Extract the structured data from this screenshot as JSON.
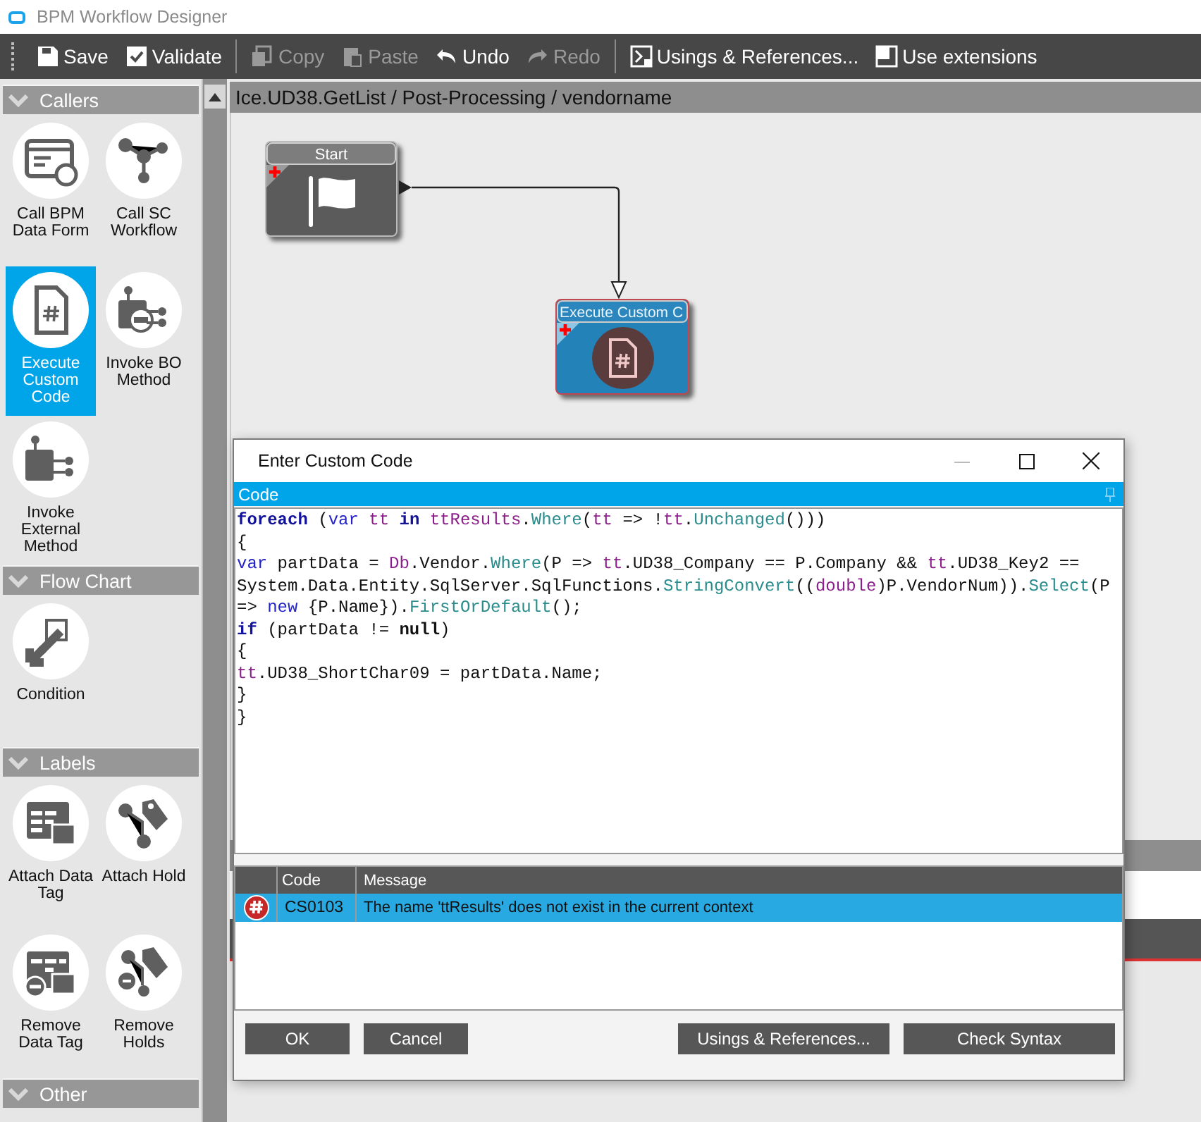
{
  "window": {
    "title": "BPM Workflow Designer"
  },
  "toolbar": {
    "groups": [
      [
        {
          "label": "Save",
          "disabled": false
        },
        {
          "label": "Validate",
          "disabled": false
        }
      ],
      [
        {
          "label": "Copy",
          "disabled": true
        },
        {
          "label": "Paste",
          "disabled": true
        },
        {
          "label": "Undo",
          "disabled": false
        },
        {
          "label": "Redo",
          "disabled": true
        }
      ],
      [
        {
          "label": "Usings & References...",
          "disabled": false
        },
        {
          "label": "Use extensions",
          "disabled": false
        }
      ]
    ]
  },
  "palette": {
    "groups": [
      {
        "title": "Callers",
        "items": [
          {
            "label": "Call BPM Data Form",
            "selected": false
          },
          {
            "label": "Call SC Workflow",
            "selected": false
          },
          {
            "label": "Execute Custom Code",
            "selected": true
          },
          {
            "label": "Invoke BO Method",
            "selected": false
          },
          {
            "label": "Invoke External Method",
            "selected": false
          }
        ]
      },
      {
        "title": "Flow Chart",
        "items": [
          {
            "label": "Condition",
            "selected": false
          }
        ]
      },
      {
        "title": "Labels",
        "items": [
          {
            "label": "Attach Data Tag",
            "selected": false
          },
          {
            "label": "Attach Hold",
            "selected": false
          },
          {
            "label": "Remove Data Tag",
            "selected": false
          },
          {
            "label": "Remove Holds",
            "selected": false
          }
        ]
      },
      {
        "title": "Other"
      }
    ]
  },
  "breadcrumb": "Ice.UD38.GetList / Post-Processing / vendorname",
  "canvas": {
    "nodes": [
      {
        "title": "Start",
        "kind": "start"
      },
      {
        "title": "Execute Custom C",
        "kind": "code"
      }
    ]
  },
  "dialog": {
    "title": "Enter Custom Code",
    "panel_title": "Code",
    "code_lines": [
      [
        {
          "text": "foreach",
          "kind": "keyword"
        },
        {
          "text": " (",
          "kind": "plain"
        },
        {
          "text": "var",
          "kind": "type"
        },
        {
          "text": " tt",
          "kind": "local"
        },
        {
          "text": " in",
          "kind": "keyword"
        },
        {
          "text": " ttResults",
          "kind": "local"
        },
        {
          "text": ".",
          "kind": "plain"
        },
        {
          "text": "Where",
          "kind": "method"
        },
        {
          "text": "(",
          "kind": "plain"
        },
        {
          "text": "tt",
          "kind": "local"
        },
        {
          "text": " => !",
          "kind": "plain"
        },
        {
          "text": "tt",
          "kind": "local"
        },
        {
          "text": ".",
          "kind": "plain"
        },
        {
          "text": "Unchanged",
          "kind": "method"
        },
        {
          "text": "()))",
          "kind": "plain"
        }
      ],
      [
        {
          "text": "{",
          "kind": "plain"
        }
      ],
      [
        {
          "text": "var",
          "kind": "type"
        },
        {
          "text": " partData = ",
          "kind": "plain"
        },
        {
          "text": "Db",
          "kind": "local"
        },
        {
          "text": ".Vendor.",
          "kind": "plain"
        },
        {
          "text": "Where",
          "kind": "method"
        },
        {
          "text": "(P => ",
          "kind": "plain"
        },
        {
          "text": "tt",
          "kind": "local"
        },
        {
          "text": ".UD38_Company == P.Company && ",
          "kind": "plain"
        },
        {
          "text": "tt",
          "kind": "local"
        },
        {
          "text": ".UD38_Key2 ==",
          "kind": "plain"
        }
      ],
      [
        {
          "text": "System.Data.Entity.SqlServer.SqlFunctions.",
          "kind": "plain"
        },
        {
          "text": "StringConvert",
          "kind": "method"
        },
        {
          "text": "((",
          "kind": "plain"
        },
        {
          "text": "double",
          "kind": "local"
        },
        {
          "text": ")P.VendorNum)).",
          "kind": "plain"
        },
        {
          "text": "Select",
          "kind": "method"
        },
        {
          "text": "(P",
          "kind": "plain"
        }
      ],
      [
        {
          "text": "=> ",
          "kind": "plain"
        },
        {
          "text": "new",
          "kind": "type"
        },
        {
          "text": " {P.Name}).",
          "kind": "plain"
        },
        {
          "text": "FirstOrDefault",
          "kind": "method"
        },
        {
          "text": "();",
          "kind": "plain"
        }
      ],
      [
        {
          "text": "if",
          "kind": "keyword"
        },
        {
          "text": " (partData != ",
          "kind": "plain"
        },
        {
          "text": "null",
          "kind": "literal"
        },
        {
          "text": ")",
          "kind": "plain"
        }
      ],
      [
        {
          "text": "{",
          "kind": "plain"
        }
      ],
      [
        {
          "text": "tt",
          "kind": "local"
        },
        {
          "text": ".UD38_ShortChar09 = partData.Name;",
          "kind": "plain"
        }
      ],
      [
        {
          "text": "}",
          "kind": "plain"
        }
      ],
      [
        {
          "text": "}",
          "kind": "plain"
        }
      ]
    ],
    "errors": {
      "columns": [
        "Code",
        "Message"
      ],
      "rows": [
        {
          "kind": "error",
          "code": "CS0103",
          "message": "The name 'ttResults' does not exist in the current context",
          "selected": true
        }
      ]
    },
    "buttons_left": [
      "OK",
      "Cancel"
    ],
    "buttons_right": [
      "Usings & References...",
      "Check Syntax"
    ]
  }
}
